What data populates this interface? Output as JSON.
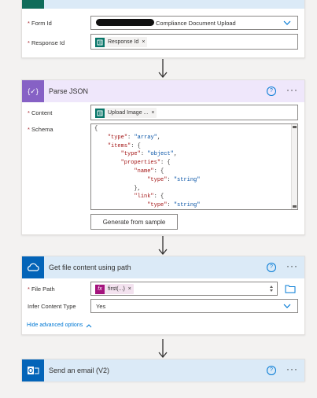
{
  "form_card": {
    "form_id_label": "Form Id",
    "form_id_value": "Compliance Document Upload",
    "response_id_label": "Response Id",
    "response_id_token": "Response Id",
    "remove_glyph": "×"
  },
  "parse_json": {
    "title": "Parse JSON",
    "content_label": "Content",
    "content_token": "Upload Image ...",
    "schema_label": "Schema",
    "schema_lines": [
      "{",
      "    \"type\": \"array\",",
      "    \"items\": {",
      "        \"type\": \"object\",",
      "        \"properties\": {",
      "            \"name\": {",
      "                \"type\": \"string\"",
      "            },",
      "            \"link\": {",
      "                \"type\": \"string\""
    ],
    "generate_button": "Generate from sample",
    "help_glyph": "?",
    "more_glyph": "···"
  },
  "get_file": {
    "title": "Get file content using path",
    "file_path_label": "File Path",
    "file_path_token": "first(...)",
    "infer_label": "Infer Content Type",
    "infer_value": "Yes",
    "hide_advanced": "Hide advanced options",
    "help_glyph": "?",
    "more_glyph": "···"
  },
  "send_email": {
    "title": "Send an email (V2)",
    "help_glyph": "?",
    "more_glyph": "···"
  },
  "required_marker": "*",
  "colors": {
    "parse_header_bg": "#efe7fb",
    "parse_icon_bg": "#8661c5",
    "file_header_bg": "#dbeaf7",
    "email_header_bg": "#dbeaf7",
    "forms_token": "#077568",
    "expression_token": "#a4137d",
    "link": "#0078d4"
  }
}
